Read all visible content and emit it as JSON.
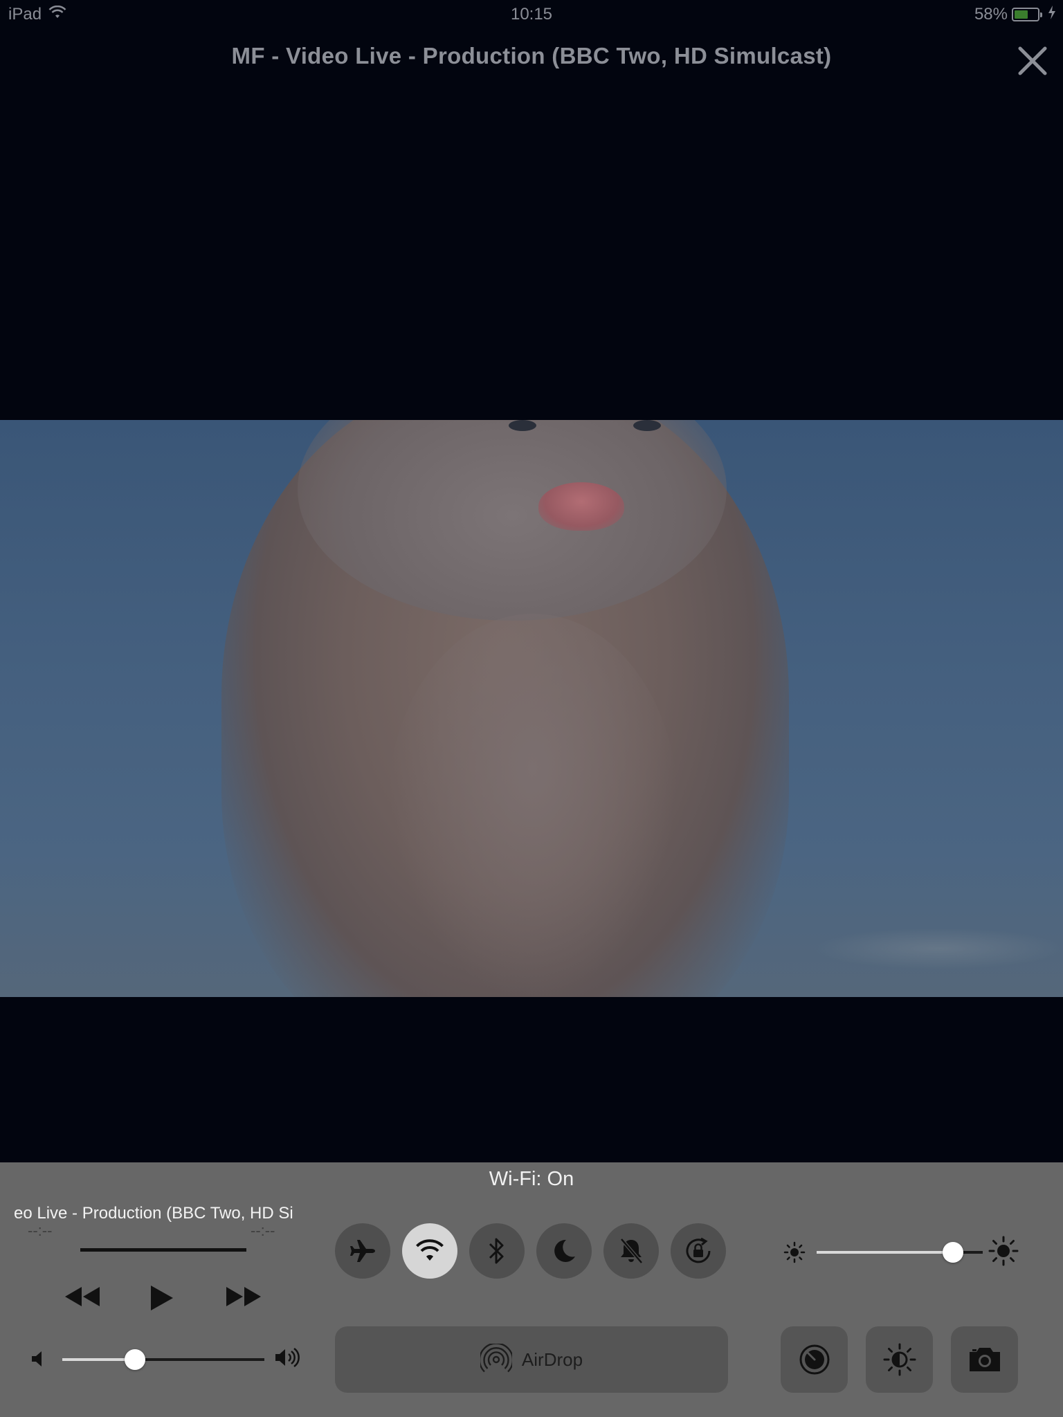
{
  "status_bar": {
    "device": "iPad",
    "time": "10:15",
    "battery_percent": "58%",
    "battery_level": 0.58,
    "wifi_icon": "wifi-icon",
    "charging_icon": "bolt-icon"
  },
  "player": {
    "title": "MF - Video Live - Production (BBC Two, HD Simulcast)",
    "close_icon": "close-icon"
  },
  "control_center": {
    "status_message": "Wi-Fi: On",
    "now_playing": {
      "title_visible": "eo Live - Production (BBC Two, HD Si",
      "elapsed": "--:--",
      "remaining": "--:--",
      "progress": 1.0,
      "buttons": [
        "rewind-icon",
        "play-icon",
        "fast-forward-icon"
      ]
    },
    "volume": {
      "level": 0.36,
      "low_icon": "volume-low-icon",
      "high_icon": "volume-high-icon"
    },
    "toggles": [
      {
        "name": "airplane-mode",
        "icon": "airplane-icon",
        "on": false
      },
      {
        "name": "wifi",
        "icon": "wifi-icon",
        "on": true
      },
      {
        "name": "bluetooth",
        "icon": "bluetooth-icon",
        "on": false
      },
      {
        "name": "do-not-disturb",
        "icon": "moon-icon",
        "on": false
      },
      {
        "name": "mute",
        "icon": "bell-slash-icon",
        "on": false
      },
      {
        "name": "rotation-lock",
        "icon": "rotation-lock-icon",
        "on": false
      }
    ],
    "brightness": {
      "level": 0.82,
      "low_icon": "sun-small-icon",
      "high_icon": "sun-large-icon"
    },
    "airdrop": {
      "label": "AirDrop",
      "icon": "airdrop-icon"
    },
    "shortcuts": [
      {
        "name": "timer",
        "icon": "timer-icon"
      },
      {
        "name": "night-shift",
        "icon": "night-shift-icon"
      },
      {
        "name": "camera",
        "icon": "camera-icon"
      }
    ],
    "colors": {
      "panel": "#676767",
      "button": "#4f4f4f",
      "button_on": "#d6d6d6"
    }
  }
}
